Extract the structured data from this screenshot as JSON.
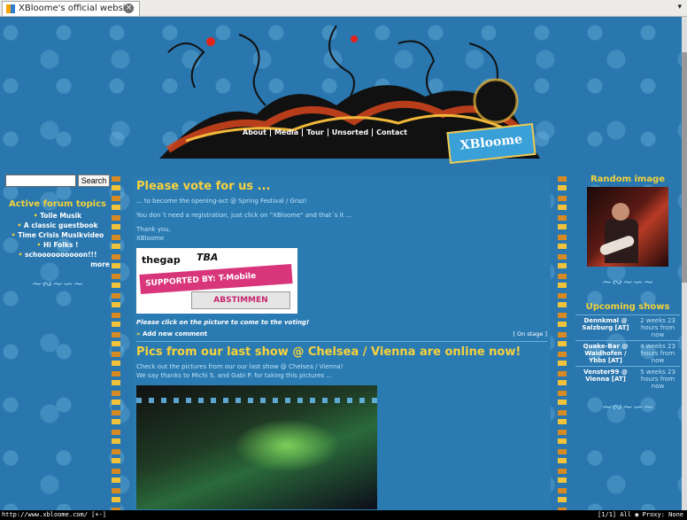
{
  "browser": {
    "tab_title": "XBloome's official website",
    "status_url": "http://www.xbloome.com/ [+-]",
    "status_right": "[1/1] All",
    "status_proxy": "Proxy: None"
  },
  "nav": [
    "About",
    "Media",
    "Tour",
    "Unsorted",
    "Contact"
  ],
  "logo_text": "XBloome",
  "search": {
    "button": "Search",
    "value": ""
  },
  "forum": {
    "title": "Active forum topics",
    "items": [
      "Tolle Musik",
      "A classic guestbook",
      "Time Crisis Musikvideo",
      "Hi Folks !",
      "schoooooooooon!!!"
    ],
    "more": "more"
  },
  "posts": [
    {
      "title": "Please vote for us ...",
      "lines": [
        "... to become the opening-act @ Spring Festival / Graz!",
        "You don´t need a registration, just click on \"XBloome\" and that´s it ...",
        "Thank you,",
        "XBloome"
      ],
      "image": {
        "thegap": "thegap",
        "tba": "TBA",
        "band": "SUPPORTED BY: T-Mobile",
        "button": "ABSTIMMEN"
      },
      "caption": "Please click on the picture to come to the voting!",
      "comment": "Add new comment",
      "tag": "[ On stage ]"
    },
    {
      "title": "Pics from our last show @ Chelsea / Vienna are online now!",
      "lines": [
        "Check out the pictures from our our last show @ Chelsea / Vienna!",
        "We say thanks to Michi S. and Gabi P. for taking this pictures ..."
      ]
    }
  ],
  "right": {
    "random_title": "Random image",
    "upcoming_title": "Upcoming shows",
    "shows": [
      {
        "name": "Dennkmal @ Salzburg [AT]",
        "when": "2 weeks 23 hours from now"
      },
      {
        "name": "Quake-Bar @ Waidhofen / Ybbs [AT]",
        "when": "4 weeks 23 hours from now"
      },
      {
        "name": "Venster99 @ Vienna [AT]",
        "when": "5 weeks 23 hours from now"
      }
    ]
  }
}
